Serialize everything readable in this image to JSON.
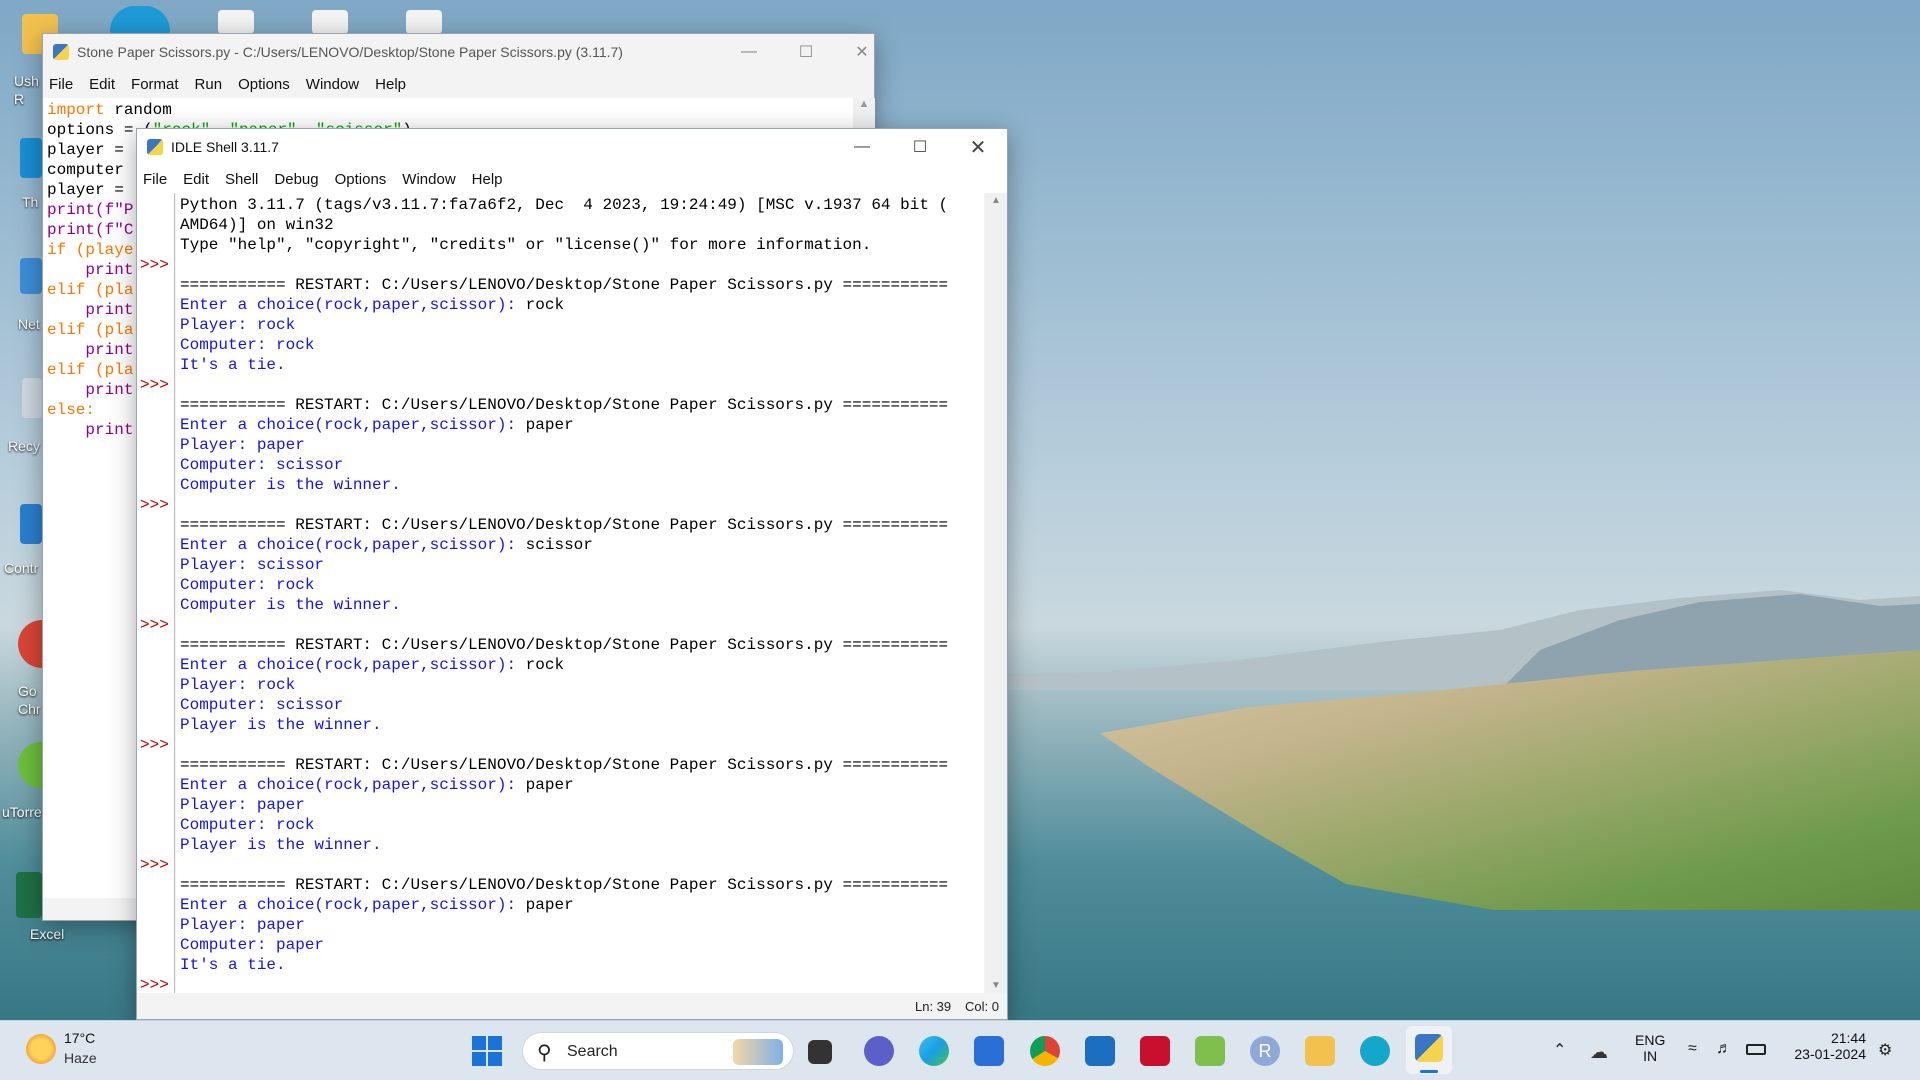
{
  "desktop": {
    "icons": [
      "Ush R",
      "Th",
      "Net",
      "Recy",
      "Contr",
      "Go Chr",
      "uTorre",
      "Excel"
    ]
  },
  "editor": {
    "title": "Stone Paper Scissors.py - C:/Users/LENOVO/Desktop/Stone Paper Scissors.py (3.11.7)",
    "menu": [
      "File",
      "Edit",
      "Format",
      "Run",
      "Options",
      "Window",
      "Help"
    ],
    "lines": [
      "import random",
      "options = (\"rock\", \"paper\", \"scissor\")",
      "player =",
      "computer",
      "player =",
      "print(f\"P",
      "print(f\"C",
      "if (playe",
      "    print",
      "elif (pla",
      "    print",
      "elif (pla",
      "    print",
      "elif (pla",
      "    print",
      "else:",
      "    print"
    ]
  },
  "shell": {
    "title": "IDLE Shell 3.11.7",
    "menu": [
      "File",
      "Edit",
      "Shell",
      "Debug",
      "Options",
      "Window",
      "Help"
    ],
    "banner": [
      "Python 3.11.7 (tags/v3.11.7:fa7a6f2, Dec  4 2023, 19:24:49) [MSC v.1937 64 bit (",
      "AMD64)] on win32",
      "Type \"help\", \"copyright\", \"credits\" or \"license()\" for more information."
    ],
    "prompt": ">>>",
    "restart_line": "=========== RESTART: C:/Users/LENOVO/Desktop/Stone Paper Scissors.py ===========",
    "runs": [
      {
        "prompt_text": "Enter a choice(rock,paper,scissor): ",
        "input": "rock",
        "player": "Player: rock",
        "computer": "Computer: rock",
        "result": "It's a tie."
      },
      {
        "prompt_text": "Enter a choice(rock,paper,scissor): ",
        "input": "paper",
        "player": "Player: paper",
        "computer": "Computer: scissor",
        "result": "Computer is the winner."
      },
      {
        "prompt_text": "Enter a choice(rock,paper,scissor): ",
        "input": "scissor",
        "player": "Player: scissor",
        "computer": "Computer: rock",
        "result": "Computer is the winner."
      },
      {
        "prompt_text": "Enter a choice(rock,paper,scissor): ",
        "input": "rock",
        "player": "Player: rock",
        "computer": "Computer: scissor",
        "result": "Player is the winner."
      },
      {
        "prompt_text": "Enter a choice(rock,paper,scissor): ",
        "input": "paper",
        "player": "Player: paper",
        "computer": "Computer: rock",
        "result": "Player is the winner."
      },
      {
        "prompt_text": "Enter a choice(rock,paper,scissor): ",
        "input": "paper",
        "player": "Player: paper",
        "computer": "Computer: paper",
        "result": "It's a tie."
      }
    ],
    "status": {
      "line": "Ln: 39",
      "col": "Col: 0"
    }
  },
  "taskbar": {
    "weather": {
      "temp": "17°C",
      "condition": "Haze"
    },
    "search_label": "Search",
    "pinned_icons": [
      "start-icon",
      "search-icon",
      "task-view-icon",
      "teams-icon",
      "edge-icon",
      "store-icon",
      "chrome-icon",
      "mail-icon",
      "mcafee-icon",
      "notepad-icon",
      "r-icon",
      "file-explorer-icon",
      "alexa-icon",
      "python-idle-icon"
    ],
    "tray": {
      "lang": "ENG",
      "region": "IN",
      "time": "21:44",
      "date": "23-01-2024"
    }
  }
}
